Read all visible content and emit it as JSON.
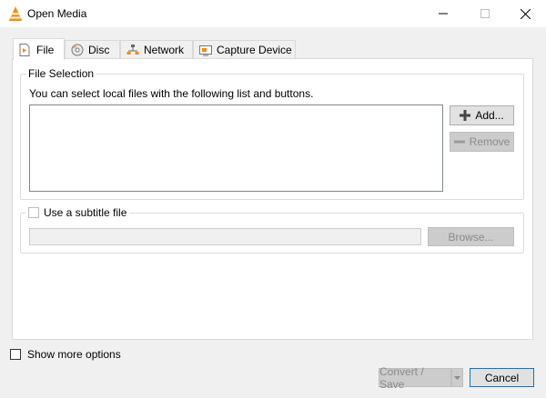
{
  "window": {
    "title": "Open Media"
  },
  "tabs": [
    {
      "label": "File",
      "icon": "file-icon"
    },
    {
      "label": "Disc",
      "icon": "disc-icon"
    },
    {
      "label": "Network",
      "icon": "network-icon"
    },
    {
      "label": "Capture Device",
      "icon": "capture-device-icon"
    }
  ],
  "file_selection": {
    "title": "File Selection",
    "description": "You can select local files with the following list and buttons.",
    "add_label": "Add...",
    "remove_label": "Remove"
  },
  "subtitle": {
    "checkbox_label": "Use a subtitle file",
    "path_value": "",
    "browse_label": "Browse..."
  },
  "footer": {
    "show_more_label": "Show more options",
    "convert_label": "Convert / Save",
    "cancel_label": "Cancel"
  },
  "colors": {
    "accent": "#ff8800",
    "window_bg": "#f0f0f0",
    "panel_bg": "#ffffff"
  }
}
